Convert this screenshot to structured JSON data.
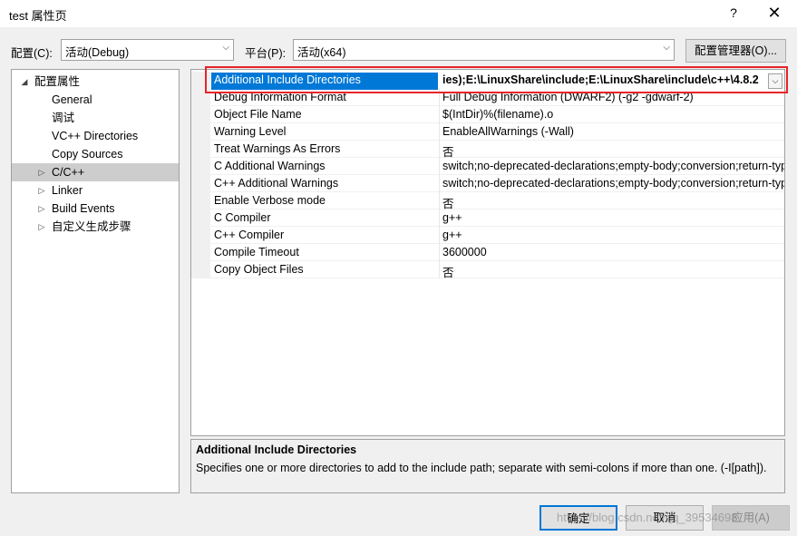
{
  "window": {
    "title": "test 属性页",
    "help_glyph": "?",
    "close_glyph": "✕"
  },
  "toolbar": {
    "config_label": "配置(C):",
    "config_value": "活动(Debug)",
    "platform_label": "平台(P):",
    "platform_value": "活动(x64)",
    "config_manager_label": "配置管理器(O)..."
  },
  "tree": {
    "items": [
      {
        "label": "配置属性",
        "expander": "◢",
        "expanded": true
      },
      {
        "label": "General"
      },
      {
        "label": "调试"
      },
      {
        "label": "VC++ Directories"
      },
      {
        "label": "Copy Sources"
      },
      {
        "label": "C/C++",
        "expander": "▷",
        "selected": true
      },
      {
        "label": "Linker",
        "expander": "▷"
      },
      {
        "label": "Build Events",
        "expander": "▷"
      },
      {
        "label": "自定义生成步骤",
        "expander": "▷"
      }
    ]
  },
  "grid": {
    "rows": [
      {
        "name": "Additional Include Directories",
        "value": "ies);E:\\LinuxShare\\include;E:\\LinuxShare\\include\\c++\\4.8.2",
        "selected": true
      },
      {
        "name": "Debug Information Format",
        "value": "Full Debug Information (DWARF2) (-g2 -gdwarf-2)"
      },
      {
        "name": "Object File Name",
        "value": "$(IntDir)%(filename).o"
      },
      {
        "name": "Warning Level",
        "value": "EnableAllWarnings (-Wall)"
      },
      {
        "name": "Treat Warnings As Errors",
        "value": "否"
      },
      {
        "name": "C Additional Warnings",
        "value": "switch;no-deprecated-declarations;empty-body;conversion;return-type"
      },
      {
        "name": "C++ Additional Warnings",
        "value": "switch;no-deprecated-declarations;empty-body;conversion;return-type"
      },
      {
        "name": "Enable Verbose mode",
        "value": "否"
      },
      {
        "name": "C Compiler",
        "value": "g++"
      },
      {
        "name": "C++ Compiler",
        "value": "g++"
      },
      {
        "name": "Compile Timeout",
        "value": "3600000"
      },
      {
        "name": "Copy Object Files",
        "value": "否"
      }
    ]
  },
  "description": {
    "title": "Additional Include Directories",
    "text": "Specifies one or more directories to add to the include path; separate with semi-colons if more than one. (-I[path])."
  },
  "buttons": {
    "ok": "确定",
    "cancel": "取消",
    "apply": "应用(A)"
  },
  "watermark": "https://blog.csdn.net/qq_39534698",
  "colors": {
    "selection": "#0078d7",
    "highlight_box": "#e8232a"
  }
}
